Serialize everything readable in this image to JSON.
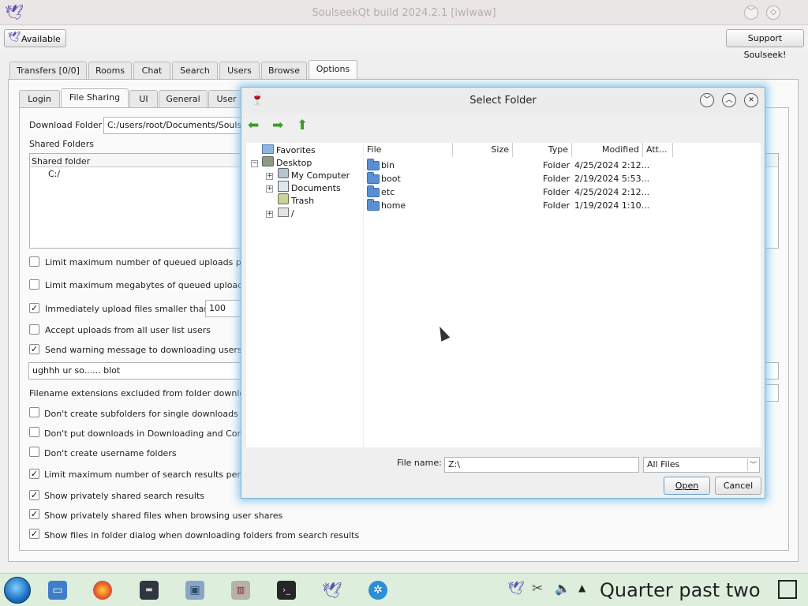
{
  "window": {
    "title": "SoulseekQt build 2024.2.1 [iwiwaw]",
    "status_label": "Available",
    "support_label": "Support Soulseek!"
  },
  "main_tabs": [
    "Transfers [0/0]",
    "Rooms",
    "Chat",
    "Search",
    "Users",
    "Browse",
    "Options"
  ],
  "options_tabs": [
    "Login",
    "File Sharing",
    "UI",
    "General",
    "User"
  ],
  "file_sharing": {
    "download_folder_label": "Download Folder",
    "download_folder_value": "C:/users/root/Documents/Soulseek",
    "shared_folders_label": "Shared Folders",
    "shared_folder_header": "Shared folder",
    "shared_folders": [
      "C:/"
    ],
    "options": [
      {
        "label": "Limit maximum number of queued uploads per",
        "checked": false
      },
      {
        "label": "Limit maximum megabytes of queued uploads p",
        "checked": false
      },
      {
        "label": "Immediately upload files smaller than",
        "checked": true,
        "value": "100"
      },
      {
        "label": "Accept uploads from all user list users",
        "checked": false
      },
      {
        "label": "Send warning message to downloading users w",
        "checked": true
      }
    ],
    "warning_message": "ughhh ur so...... blot",
    "excluded_ext_label": "Filename extensions excluded from folder downloa",
    "options2": [
      {
        "label": "Don't create subfolders for single downloads",
        "checked": false
      },
      {
        "label": "Don't put downloads in Downloading and Comp",
        "checked": false
      },
      {
        "label": "Don't create username folders",
        "checked": false
      },
      {
        "label": "Limit maximum number of search results per se",
        "checked": true
      },
      {
        "label": "Show privately shared search results",
        "checked": true
      },
      {
        "label": "Show privately shared files when browsing user shares",
        "checked": true
      },
      {
        "label": "Show files in folder dialog when downloading folders from search results",
        "checked": true
      }
    ]
  },
  "dialog": {
    "title": "Select Folder",
    "tree": [
      {
        "label": "Favorites",
        "icon": "star-folder-icon"
      },
      {
        "label": "Desktop",
        "icon": "desktop-icon"
      },
      {
        "label": "My Computer",
        "icon": "computer-icon"
      },
      {
        "label": "Documents",
        "icon": "documents-icon"
      },
      {
        "label": "Trash",
        "icon": "trash-icon"
      },
      {
        "label": "/",
        "icon": "drive-icon"
      }
    ],
    "columns": {
      "file": "File",
      "size": "Size",
      "type": "Type",
      "modified": "Modified",
      "attr": "Att..."
    },
    "files": [
      {
        "name": "bin",
        "type": "Folder",
        "modified": "4/25/2024 2:12..."
      },
      {
        "name": "boot",
        "type": "Folder",
        "modified": "2/19/2024 5:53..."
      },
      {
        "name": "etc",
        "type": "Folder",
        "modified": "4/25/2024 2:12..."
      },
      {
        "name": "home",
        "type": "Folder",
        "modified": "1/19/2024 1:10..."
      }
    ],
    "filename_label": "File name:",
    "filename_value": "Z:\\",
    "filter_value": "All Files",
    "open_label": "Open",
    "cancel_label": "Cancel"
  },
  "taskbar": {
    "clock": "Quarter past two"
  },
  "colors": {
    "selection_glow": "#7db3d6",
    "folder": "#5a8fd6",
    "taskbar": "#ddeedd",
    "app_bird": "#5b4fb3"
  }
}
